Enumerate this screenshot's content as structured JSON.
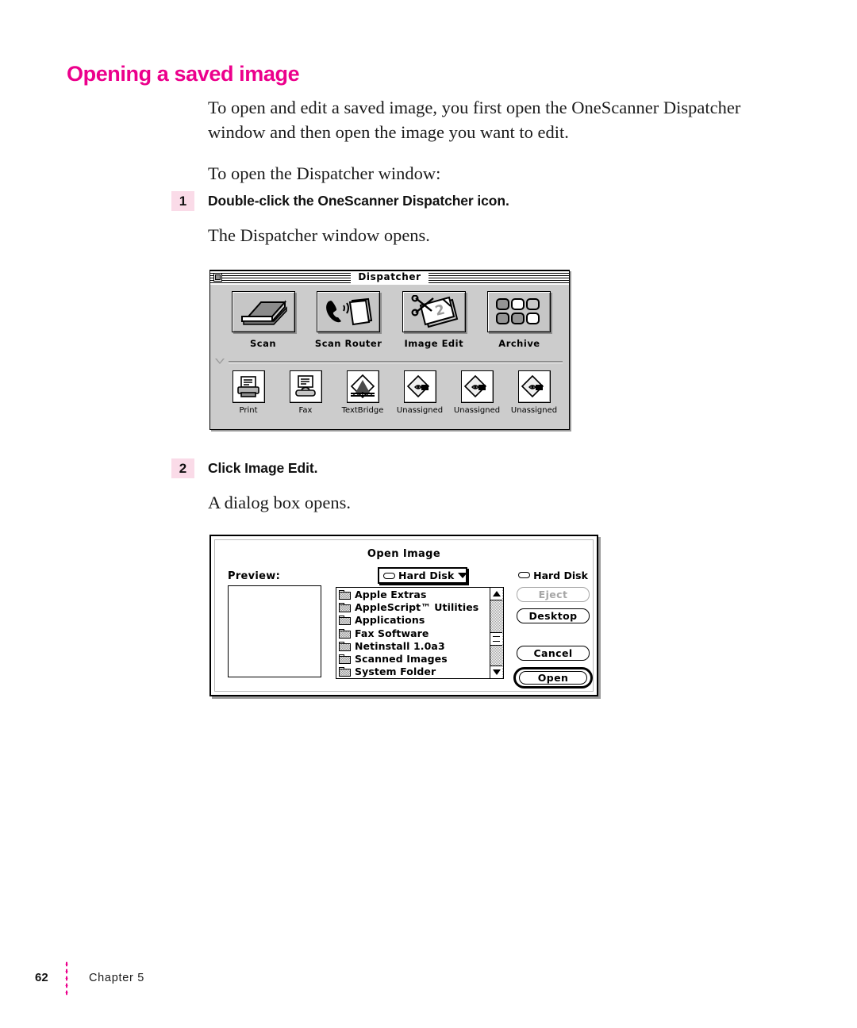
{
  "page": {
    "heading": "Opening a saved image",
    "intro_paragraph": "To open and edit a saved image, you first open the OneScanner Dispatcher window and then open the image you want to edit.",
    "lead_in": "To open the Dispatcher window:",
    "folio": "62",
    "chapter": "Chapter 5",
    "accent_color": "#ec008c",
    "step_badge_color": "#fadbe8"
  },
  "steps": [
    {
      "number": "1",
      "instruction": "Double-click the OneScanner Dispatcher icon.",
      "result": "The Dispatcher window opens."
    },
    {
      "number": "2",
      "instruction": "Click Image Edit.",
      "result": "A dialog box opens."
    }
  ],
  "dispatcher_window": {
    "title": "Dispatcher",
    "close_box_icon": "close-box-icon",
    "disclosure_icon": "disclosure-triangle-icon",
    "primary_items": [
      {
        "label": "Scan",
        "icon": "scanner-icon"
      },
      {
        "label": "Scan Router",
        "icon": "phone-pages-icon"
      },
      {
        "label": "Image Edit",
        "icon": "scissors-photo-icon"
      },
      {
        "label": "Archive",
        "icon": "grid-tiles-icon"
      }
    ],
    "secondary_items": [
      {
        "label": "Print",
        "icon": "printer-icon"
      },
      {
        "label": "Fax",
        "icon": "fax-icon"
      },
      {
        "label": "TextBridge",
        "icon": "textbridge-icon"
      },
      {
        "label": "Unassigned",
        "icon": "unassigned-diamond-icon"
      },
      {
        "label": "Unassigned",
        "icon": "unassigned-diamond-icon"
      },
      {
        "label": "Unassigned",
        "icon": "unassigned-diamond-icon"
      }
    ]
  },
  "open_dialog": {
    "title": "Open Image",
    "preview_label": "Preview:",
    "volume_popup": {
      "value": "Hard Disk",
      "disk_icon": "hard-disk-icon",
      "arrow_icon": "chevron-down-icon"
    },
    "current_disk": {
      "name": "Hard Disk",
      "icon": "hard-disk-icon"
    },
    "files": [
      "Apple Extras",
      "AppleScript™ Utilities",
      "Applications",
      "Fax Software",
      "Netinstall 1.0a3",
      "Scanned Images",
      "System Folder"
    ],
    "scrollbar": {
      "up_icon": "scroll-up-arrow-icon",
      "down_icon": "scroll-down-arrow-icon",
      "thumb_icon": "scroll-thumb"
    },
    "buttons": [
      {
        "label": "Eject",
        "state": "disabled"
      },
      {
        "label": "Desktop",
        "state": "enabled"
      },
      {
        "label": "Cancel",
        "state": "enabled"
      },
      {
        "label": "Open",
        "state": "default"
      }
    ]
  }
}
